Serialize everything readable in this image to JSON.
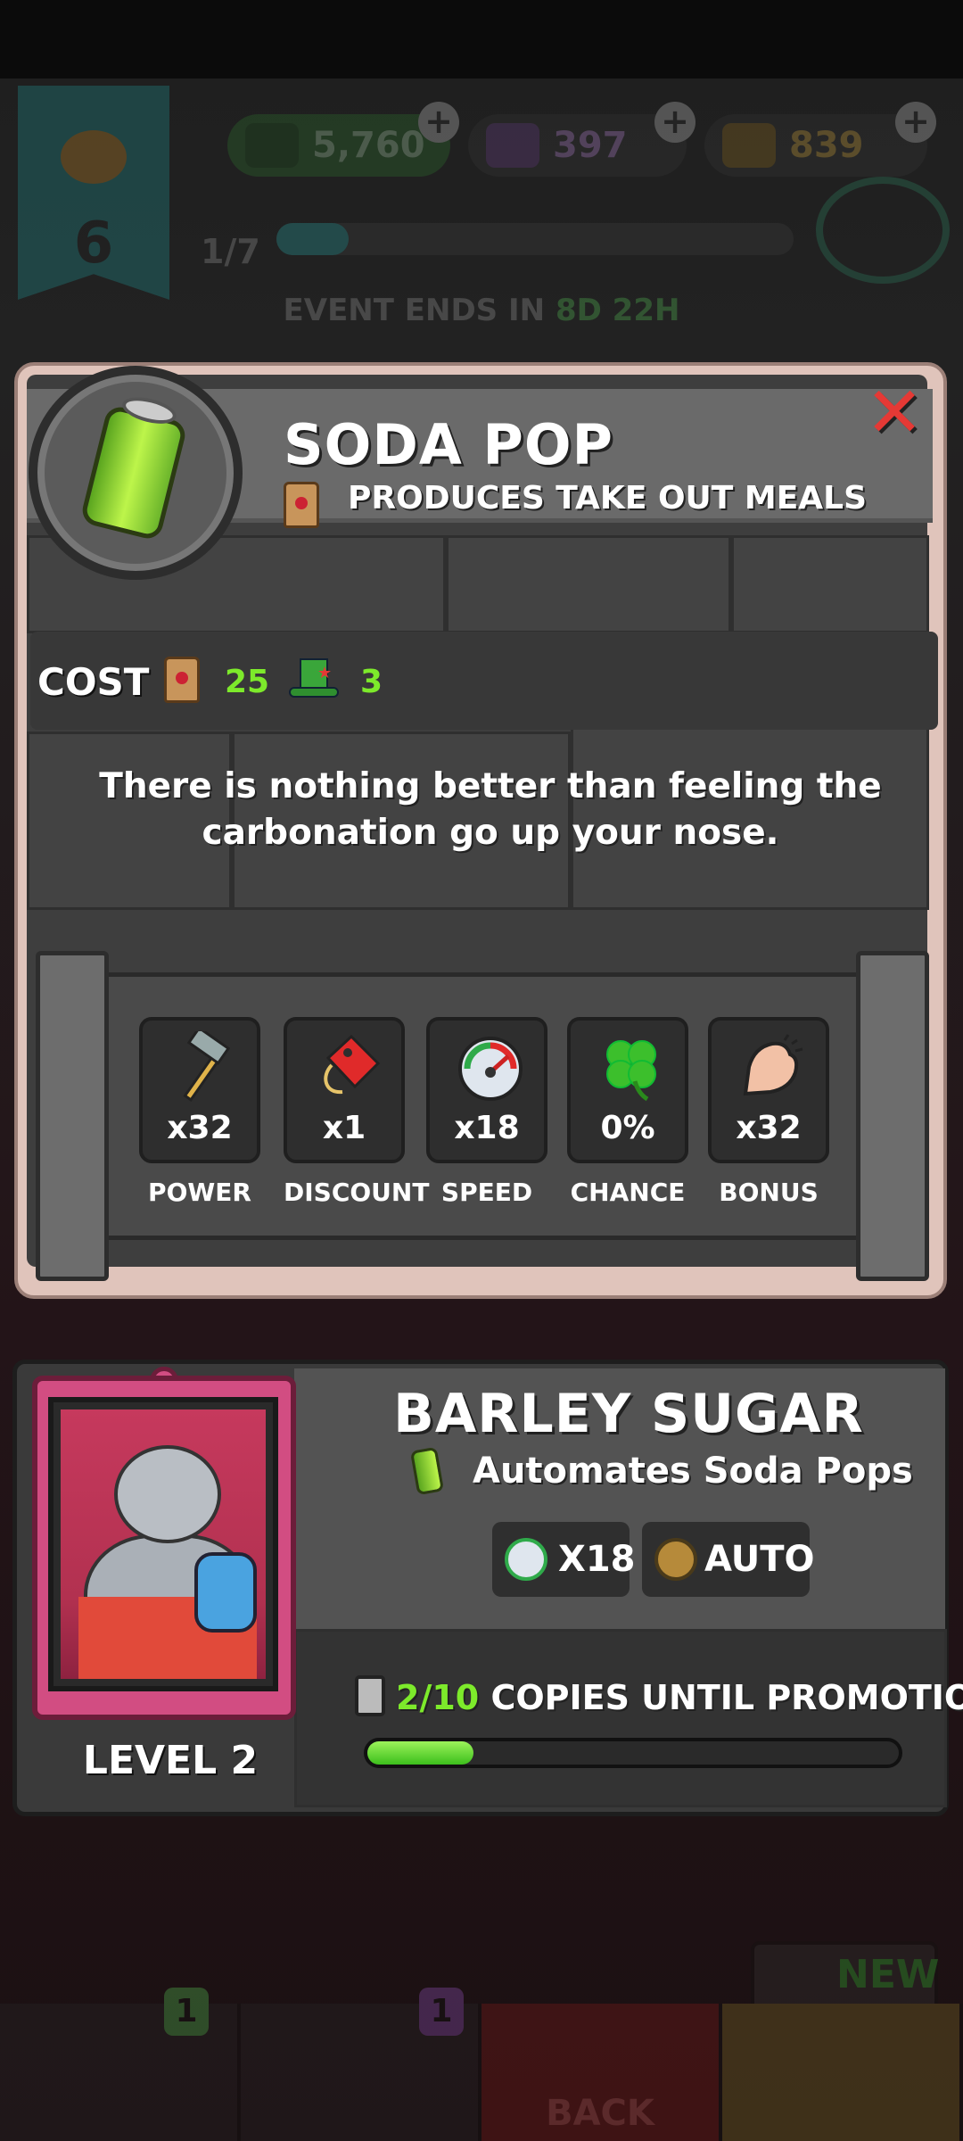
{
  "hud": {
    "level_badge": "6",
    "currencies": [
      {
        "name": "cash",
        "value": "5,760",
        "icon": "green-hat-icon"
      },
      {
        "name": "potion",
        "value": "397",
        "icon": "potion-icon"
      },
      {
        "name": "gold",
        "value": "839",
        "icon": "gold-bar-icon"
      }
    ],
    "progress_text": "1/7",
    "progress_fraction": 0.14,
    "event_prefix": "EVENT ENDS IN",
    "event_time": "8D 22H"
  },
  "item": {
    "name": "SODA POP",
    "produces": "PRODUCES TAKE OUT MEALS",
    "cost_label": "COST",
    "cost_bags": "25",
    "cost_hats": "3",
    "description": "There is nothing better than feeling the carbonation go up your nose.",
    "icon": "soda-can-icon"
  },
  "stats": [
    {
      "value": "x32",
      "label": "POWER",
      "icon": "hammer-icon"
    },
    {
      "value": "x1",
      "label": "DISCOUNT",
      "icon": "price-tag-icon"
    },
    {
      "value": "x18",
      "label": "SPEED",
      "icon": "speedometer-icon"
    },
    {
      "value": "0%",
      "label": "CHANCE",
      "icon": "clover-icon"
    },
    {
      "value": "x32",
      "label": "BONUS",
      "icon": "muscle-arm-icon"
    }
  ],
  "character": {
    "name": "BARLEY SUGAR",
    "automates": "Automates Soda Pops",
    "speed_chip": "X18",
    "auto_chip": "AUTO",
    "level": "LEVEL 2",
    "copies_count": "2/10",
    "copies_text": "COPIES UNTIL PROMOTION",
    "copies_fraction": 0.2
  },
  "bottom_nav": {
    "new_label": "NEW",
    "back_label": "BACK",
    "badge_1": "1",
    "badge_2": "1"
  },
  "colors": {
    "accent_green": "#7dea2b",
    "close_red": "#e53935",
    "frame_pink": "#d24d82"
  }
}
